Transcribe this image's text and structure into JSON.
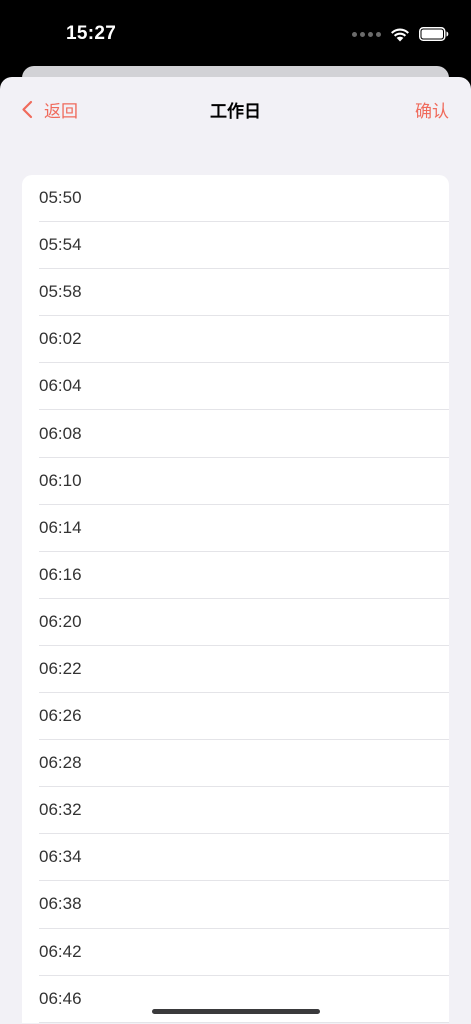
{
  "status_bar": {
    "time": "15:27"
  },
  "nav": {
    "back_label": "返回",
    "title": "工作日",
    "confirm_label": "确认"
  },
  "times": [
    "05:50",
    "05:54",
    "05:58",
    "06:02",
    "06:04",
    "06:08",
    "06:10",
    "06:14",
    "06:16",
    "06:20",
    "06:22",
    "06:26",
    "06:28",
    "06:32",
    "06:34",
    "06:38",
    "06:42",
    "06:46"
  ],
  "colors": {
    "accent": "#f06b5c",
    "background": "#f2f1f6",
    "list_background": "#ffffff",
    "text": "#333333"
  }
}
